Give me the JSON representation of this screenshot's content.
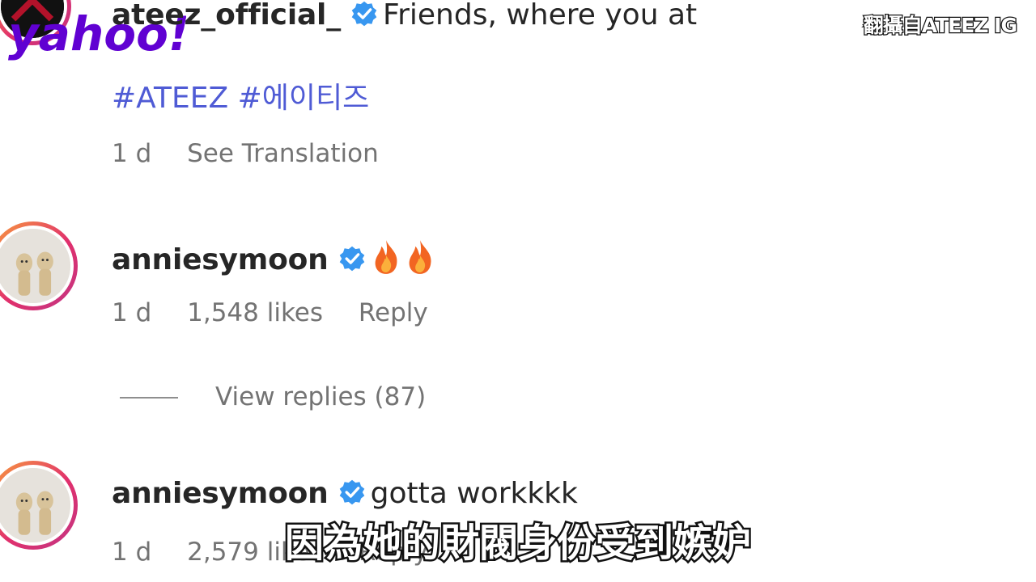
{
  "watermark": {
    "brand": "yahoo!",
    "brand_color": "#6001d2",
    "source_credit": "翻攝自ATEEZ IG"
  },
  "post": {
    "username": "ateez_official_",
    "caption": "Friends, where you at",
    "hashtags": "#ATEEZ #에이티즈",
    "time": "1 d",
    "see_translation": "See Translation",
    "verified_icon": "verified-badge-icon"
  },
  "comments": [
    {
      "username": "anniesymoon",
      "text": "",
      "emoji": [
        "fire-emoji",
        "fire-emoji"
      ],
      "time": "1 d",
      "likes": "1,548 likes",
      "reply": "Reply",
      "view_replies": "View replies (87)"
    },
    {
      "username": "anniesymoon",
      "text": "gotta workkkk",
      "time": "1 d",
      "likes": "2,579 likes",
      "reply": "Reply"
    }
  ],
  "subtitle": "因為她的財閥身份受到嫉妒",
  "colors": {
    "hashtag": "#4f5bd5",
    "verified": "#3897f0",
    "meta_text": "#737373",
    "primary_text": "#262626"
  }
}
